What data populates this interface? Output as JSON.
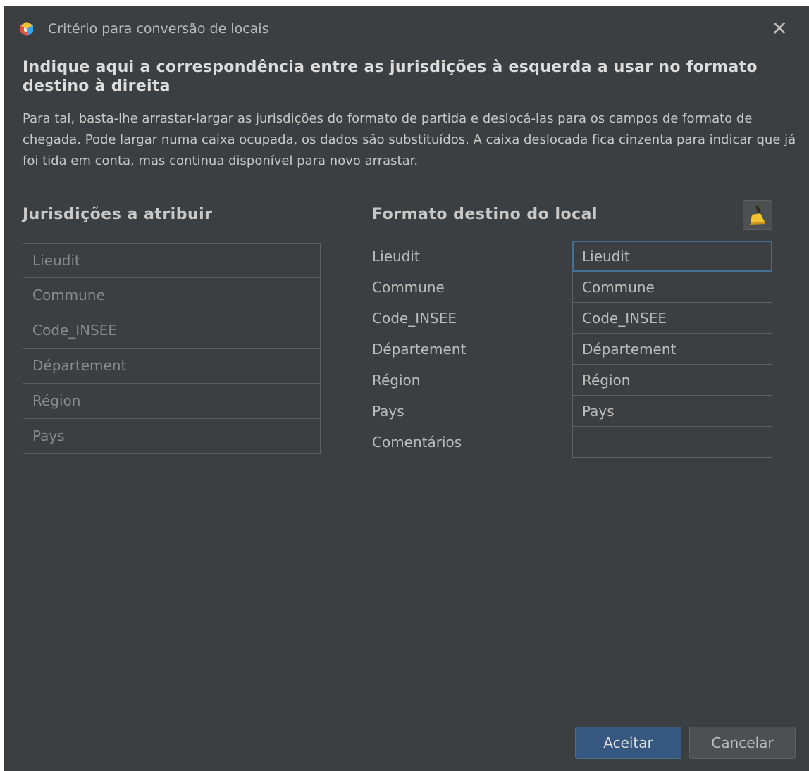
{
  "window": {
    "title": "Critério para conversão de locais",
    "close_icon": "close-icon"
  },
  "heading": "Indique aqui a correspondência entre as jurisdições à esquerda a usar no formato destino à direita",
  "description": "Para tal, basta-lhe arrastar-largar as jurisdições do formato de partida e deslocá-las para os campos de formato de chegada. Pode largar numa caixa ocupada, os dados são substituídos. A caixa deslocada fica cinzenta para indicar que já foi tida em conta, mas continua disponível para novo arrastar.",
  "source": {
    "title": "Jurisdições a atribuir",
    "items": [
      "Lieudit",
      "Commune",
      "Code_INSEE",
      "Département",
      "Région",
      "Pays"
    ]
  },
  "target": {
    "title": "Formato destino do local",
    "clean_icon": "broom-icon",
    "rows": [
      {
        "label": "Lieudit",
        "value": "Lieudit"
      },
      {
        "label": "Commune",
        "value": "Commune"
      },
      {
        "label": "Code_INSEE",
        "value": "Code_INSEE"
      },
      {
        "label": "Département",
        "value": "Département"
      },
      {
        "label": "Région",
        "value": "Région"
      },
      {
        "label": "Pays",
        "value": "Pays"
      },
      {
        "label": "Comentários",
        "value": ""
      }
    ]
  },
  "buttons": {
    "ok_label": "Aceitar",
    "cancel_label": "Cancelar"
  },
  "colors": {
    "background": "#3c3f41",
    "accent": "#365880",
    "focus_border": "#466d94"
  }
}
